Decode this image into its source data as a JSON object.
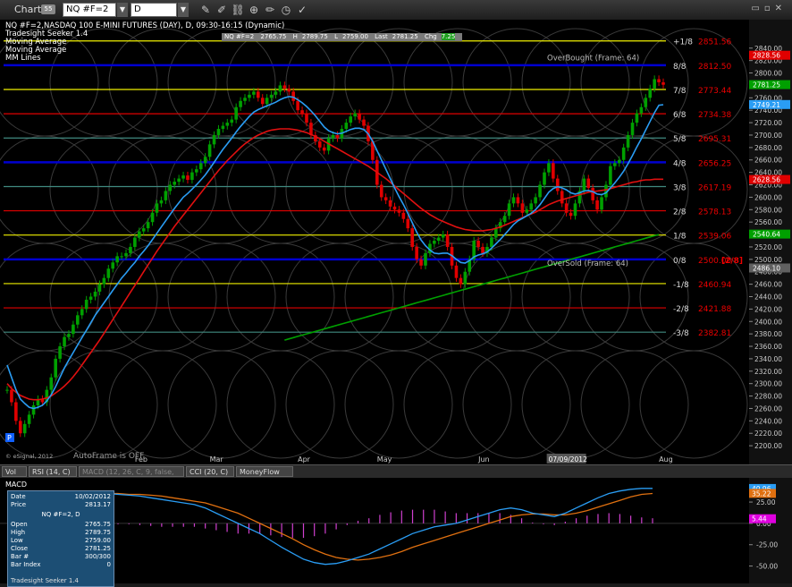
{
  "window": {
    "title": "Chart",
    "badge": "55"
  },
  "toolbar": {
    "symbol": "NQ #F=2",
    "interval": "D"
  },
  "header_lines": [
    "NQ #F=2,NASDAQ 100 E-MINI FUTURES (DAY), D, 09:30-16:15 (Dynamic)",
    "Tradesight Seeker 1.4",
    "Moving Average",
    "Moving Average",
    "MM Lines"
  ],
  "ohlc": {
    "symbol": "NQ #F=2",
    "open": "2765.75",
    "high": "2789.75",
    "low": "2759.00",
    "last": "2781.25",
    "chg": "7.25",
    "high_label": "H",
    "low_label": "L",
    "last_label": "Last",
    "chg_label": "Chg"
  },
  "labels": {
    "overbought": "OverBought (Frame: 64)",
    "oversold": "OverSold (Frame: 64)",
    "autoframe": "AutoFrame is OFF",
    "copyright": "© eSignal, 2012",
    "p_marker": "P",
    "bracket": "[2/8]"
  },
  "colors": {
    "up": "#00a000",
    "down": "#e00000",
    "ma_fast": "#2a9df4",
    "ma_slow": "#e01010",
    "ma_long": "#00a000",
    "yellow": "#f0f000",
    "blue": "#0000d0"
  },
  "chart_data": {
    "type": "candlestick",
    "title": "NQ #F=2,NASDAQ 100 E-MINI FUTURES (DAY), D",
    "ylim": [
      2180,
      2880
    ],
    "yticks": [
      2200,
      2220,
      2240,
      2260,
      2280,
      2300,
      2320,
      2340,
      2360,
      2380,
      2400,
      2420,
      2440,
      2460,
      2480,
      2500,
      2520,
      2540,
      2560,
      2580,
      2600,
      2620,
      2640,
      2660,
      2680,
      2700,
      2720,
      2740,
      2760,
      2780,
      2800,
      2820,
      2840
    ],
    "x_months": [
      {
        "label": "Feb",
        "index": 29
      },
      {
        "label": "Mar",
        "index": 46
      },
      {
        "label": "Apr",
        "index": 66
      },
      {
        "label": "May",
        "index": 84
      },
      {
        "label": "Jun",
        "index": 107
      },
      {
        "label": "Aug",
        "index": 148
      }
    ],
    "x_highlight": {
      "label": "07/09/2012",
      "index": 127
    },
    "mm_lines": [
      {
        "label": "+1/8",
        "value": 2851.56,
        "color": "#f0f000"
      },
      {
        "label": "8/8",
        "value": 2812.5,
        "color": "#0000d0"
      },
      {
        "label": "7/8",
        "value": 2773.44,
        "color": "#f0f000"
      },
      {
        "label": "6/8",
        "value": 2734.38,
        "color": "#e00000"
      },
      {
        "label": "5/8",
        "value": 2695.31,
        "color": "#408a80"
      },
      {
        "label": "4/8",
        "value": 2656.25,
        "color": "#0000d0"
      },
      {
        "label": "3/8",
        "value": 2617.19,
        "color": "#408a80"
      },
      {
        "label": "2/8",
        "value": 2578.13,
        "color": "#e00000"
      },
      {
        "label": "1/8",
        "value": 2539.06,
        "color": "#f0f000"
      },
      {
        "label": "0/8",
        "value": 2500.0,
        "color": "#0000d0"
      },
      {
        "label": "-1/8",
        "value": 2460.94,
        "color": "#f0f000"
      },
      {
        "label": "-2/8",
        "value": 2421.88,
        "color": "#e00000"
      },
      {
        "label": "-3/8",
        "value": 2382.81,
        "color": "#408a80"
      }
    ],
    "value_labels": [
      {
        "value": 2828.56,
        "text": "2828.56",
        "color": "#e00000"
      },
      {
        "value": 2781.25,
        "text": "2781.25",
        "color": "#00a000"
      },
      {
        "value": 2749.21,
        "text": "2749.21",
        "color": "#2a9df4"
      },
      {
        "value": 2628.56,
        "text": "2628.56",
        "color": "#e00000"
      },
      {
        "value": 2540.64,
        "text": "2540.64",
        "color": "#00a000"
      },
      {
        "value": 2486.1,
        "text": "2486.10",
        "color": "#606060"
      }
    ],
    "close": [
      2290,
      2270,
      2240,
      2220,
      2235,
      2250,
      2265,
      2275,
      2270,
      2290,
      2310,
      2340,
      2360,
      2375,
      2380,
      2395,
      2410,
      2420,
      2435,
      2440,
      2448,
      2460,
      2470,
      2485,
      2495,
      2505,
      2505,
      2510,
      2520,
      2535,
      2545,
      2550,
      2560,
      2575,
      2590,
      2595,
      2610,
      2620,
      2625,
      2630,
      2635,
      2628,
      2640,
      2645,
      2655,
      2665,
      2685,
      2700,
      2710,
      2715,
      2720,
      2725,
      2745,
      2755,
      2760,
      2765,
      2770,
      2760,
      2750,
      2760,
      2765,
      2770,
      2780,
      2775,
      2770,
      2755,
      2740,
      2735,
      2720,
      2700,
      2690,
      2680,
      2675,
      2695,
      2700,
      2695,
      2710,
      2720,
      2730,
      2735,
      2725,
      2715,
      2690,
      2660,
      2620,
      2600,
      2595,
      2585,
      2580,
      2575,
      2565,
      2550,
      2520,
      2500,
      2490,
      2510,
      2525,
      2530,
      2535,
      2540,
      2520,
      2490,
      2470,
      2460,
      2480,
      2500,
      2530,
      2520,
      2510,
      2520,
      2535,
      2550,
      2560,
      2570,
      2590,
      2600,
      2590,
      2575,
      2580,
      2590,
      2600,
      2620,
      2640,
      2655,
      2630,
      2610,
      2590,
      2575,
      2570,
      2590,
      2610,
      2630,
      2615,
      2595,
      2580,
      2600,
      2620,
      2650,
      2655,
      2660,
      2680,
      2700,
      2720,
      2735,
      2745,
      2760,
      2775,
      2790,
      2785,
      2781
    ],
    "ma_fast": [
      2330,
      2310,
      2290,
      2275,
      2268,
      2262,
      2260,
      2262,
      2265,
      2272,
      2282,
      2295,
      2310,
      2325,
      2338,
      2350,
      2362,
      2374,
      2386,
      2398,
      2410,
      2420,
      2430,
      2440,
      2450,
      2460,
      2470,
      2478,
      2487,
      2495,
      2505,
      2513,
      2522,
      2532,
      2542,
      2552,
      2562,
      2572,
      2582,
      2591,
      2600,
      2606,
      2613,
      2620,
      2628,
      2636,
      2646,
      2656,
      2667,
      2677,
      2686,
      2695,
      2705,
      2714,
      2722,
      2730,
      2737,
      2741,
      2744,
      2747,
      2750,
      2753,
      2757,
      2760,
      2762,
      2761,
      2757,
      2752,
      2746,
      2739,
      2731,
      2722,
      2713,
      2707,
      2704,
      2702,
      2703,
      2706,
      2709,
      2711,
      2711,
      2709,
      2702,
      2690,
      2675,
      2660,
      2645,
      2630,
      2615,
      2601,
      2588,
      2574,
      2559,
      2544,
      2531,
      2522,
      2515,
      2510,
      2509,
      2510,
      2510,
      2506,
      2500,
      2495,
      2494,
      2498,
      2504,
      2507,
      2509,
      2512,
      2518,
      2525,
      2532,
      2540,
      2548,
      2556,
      2562,
      2566,
      2570,
      2574,
      2580,
      2588,
      2598,
      2608,
      2614,
      2617,
      2615,
      2612,
      2607,
      2605,
      2607,
      2610,
      2611,
      2609,
      2605,
      2604,
      2607,
      2615,
      2623,
      2632,
      2642,
      2654,
      2667,
      2681,
      2694,
      2708,
      2722,
      2736,
      2748,
      2749
    ],
    "ma_slow": [
      2300,
      2292,
      2286,
      2281,
      2278,
      2275,
      2274,
      2274,
      2275,
      2277,
      2280,
      2285,
      2290,
      2296,
      2303,
      2311,
      2320,
      2330,
      2340,
      2350,
      2360,
      2370,
      2381,
      2392,
      2403,
      2414,
      2425,
      2436,
      2447,
      2458,
      2469,
      2480,
      2491,
      2502,
      2513,
      2523,
      2533,
      2543,
      2553,
      2562,
      2571,
      2580,
      2589,
      2598,
      2607,
      2616,
      2625,
      2634,
      2643,
      2651,
      2659,
      2666,
      2673,
      2680,
      2686,
      2691,
      2696,
      2700,
      2703,
      2706,
      2708,
      2709,
      2710,
      2710,
      2710,
      2709,
      2708,
      2706,
      2704,
      2701,
      2698,
      2694,
      2690,
      2686,
      2682,
      2678,
      2674,
      2670,
      2666,
      2662,
      2658,
      2654,
      2650,
      2645,
      2640,
      2635,
      2630,
      2624,
      2618,
      2612,
      2606,
      2600,
      2594,
      2588,
      2582,
      2577,
      2572,
      2568,
      2564,
      2561,
      2558,
      2555,
      2552,
      2550,
      2548,
      2547,
      2546,
      2546,
      2546,
      2547,
      2548,
      2550,
      2552,
      2555,
      2558,
      2561,
      2564,
      2567,
      2570,
      2573,
      2576,
      2580,
      2584,
      2588,
      2591,
      2594,
      2596,
      2598,
      2600,
      2602,
      2604,
      2606,
      2608,
      2609,
      2610,
      2611,
      2612,
      2614,
      2616,
      2618,
      2620,
      2622,
      2624,
      2625,
      2627,
      2628,
      2628,
      2629,
      2629,
      2629
    ],
    "ma_long": [
      2370,
      2372,
      2374,
      2376,
      2378,
      2380,
      2382,
      2384,
      2386,
      2388,
      2390,
      2392,
      2394,
      2396,
      2398,
      2400,
      2402,
      2404,
      2406,
      2408,
      2410,
      2412,
      2414,
      2416,
      2418,
      2420,
      2422,
      2424,
      2426,
      2428,
      2430,
      2432,
      2434,
      2436,
      2438,
      2440,
      2442,
      2444,
      2446,
      2448,
      2450,
      2452,
      2454,
      2456,
      2458,
      2460,
      2462,
      2464,
      2466,
      2468,
      2470,
      2472,
      2474,
      2476,
      2478,
      2480,
      2482,
      2484,
      2486,
      2488,
      2490,
      2492,
      2494,
      2496,
      2498,
      2500,
      2502,
      2504,
      2506,
      2508,
      2510,
      2512,
      2514,
      2516,
      2518,
      2520,
      2522,
      2524,
      2526,
      2528,
      2530,
      2532,
      2534,
      2536,
      2538,
      2540
    ],
    "ma_long_start_index": 63
  },
  "tabs": [
    "Vol",
    "RSI (14, C)",
    "MACD (12, 26, C, 9, false, true)",
    "CCI (20, C)",
    "MoneyFlow (14)"
  ],
  "macd": {
    "label": "MACD",
    "yticks": [
      25,
      0,
      -25,
      -50
    ],
    "ylim": [
      -62,
      45
    ],
    "value_labels": [
      {
        "value": 40.9,
        "text": "40.96",
        "color": "#2a9df4"
      },
      {
        "value": 35.2,
        "text": "35.22",
        "color": "#e07010"
      },
      {
        "value": 5.44,
        "text": "5.44",
        "color": "#e000e0"
      }
    ],
    "macd_line": [
      35,
      36,
      35,
      34,
      33,
      34,
      35,
      35,
      36,
      35,
      34,
      33,
      32,
      30,
      28,
      26,
      24,
      22,
      18,
      12,
      6,
      0,
      -6,
      -12,
      -20,
      -28,
      -35,
      -42,
      -46,
      -48,
      -47,
      -44,
      -40,
      -36,
      -30,
      -24,
      -18,
      -12,
      -8,
      -4,
      -2,
      0,
      4,
      8,
      12,
      16,
      18,
      16,
      12,
      10,
      8,
      12,
      18,
      24,
      30,
      35,
      38,
      40,
      41,
      41
    ],
    "signal_line": [
      30,
      31,
      31,
      32,
      32,
      33,
      33,
      34,
      34,
      35,
      35,
      34,
      34,
      33,
      32,
      30,
      28,
      26,
      24,
      20,
      16,
      12,
      6,
      0,
      -6,
      -12,
      -18,
      -25,
      -31,
      -36,
      -40,
      -42,
      -43,
      -42,
      -40,
      -37,
      -33,
      -28,
      -24,
      -20,
      -16,
      -12,
      -8,
      -4,
      0,
      4,
      8,
      10,
      11,
      11,
      10,
      10,
      12,
      15,
      19,
      23,
      27,
      31,
      34,
      35
    ]
  },
  "data_window": {
    "date_label": "Date",
    "date": "10/02/2012",
    "price_label": "Price",
    "price": "2813.17",
    "symbol": "NQ #F=2, D",
    "rows": [
      {
        "k": "Open",
        "v": "2765.75"
      },
      {
        "k": "High",
        "v": "2789.75"
      },
      {
        "k": "Low",
        "v": "2759.00"
      },
      {
        "k": "Close",
        "v": "2781.25"
      },
      {
        "k": "Bar #",
        "v": "300/300"
      },
      {
        "k": "Bar Index",
        "v": "0"
      }
    ],
    "footer": "Tradesight Seeker 1.4"
  }
}
